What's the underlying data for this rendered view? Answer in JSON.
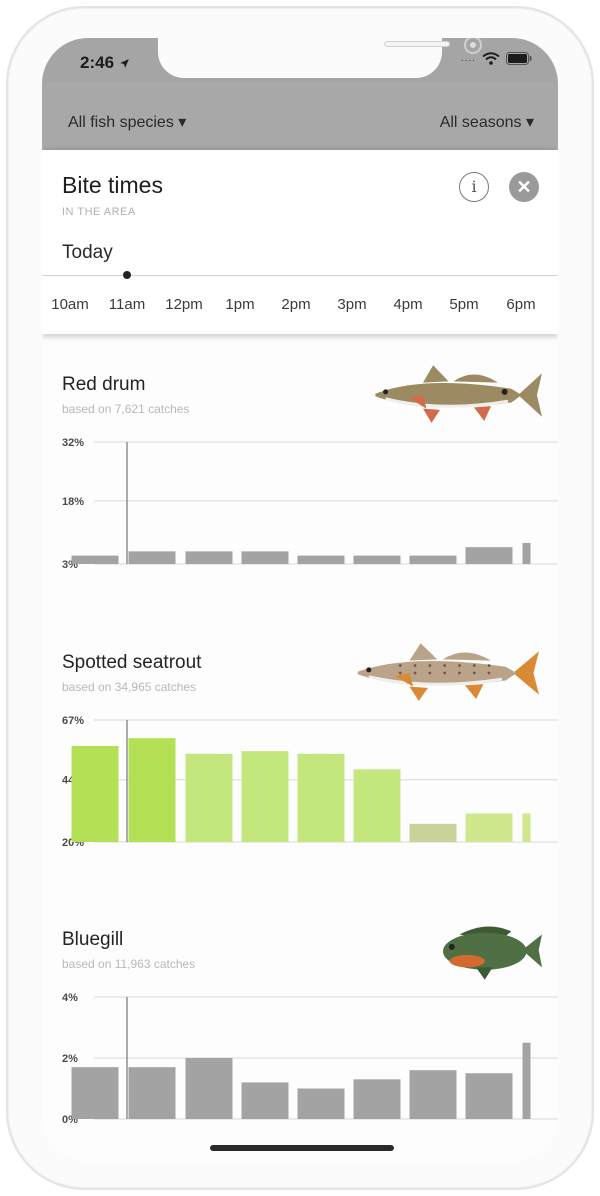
{
  "status_bar": {
    "time": "2:46",
    "location_icon": "location-arrow-icon",
    "signal": "....",
    "wifi_icon": "wifi-icon",
    "battery_icon": "battery-icon"
  },
  "filters": {
    "species": "All fish species ▾",
    "seasons": "All seasons ▾"
  },
  "sheet": {
    "title": "Bite times",
    "subtitle": "IN THE AREA",
    "info_label": "i",
    "close_label": "✕",
    "day": "Today",
    "hours": [
      "10am",
      "11am",
      "12pm",
      "1pm",
      "2pm",
      "3pm",
      "4pm",
      "5pm",
      "6pm"
    ],
    "current_time_index": 1
  },
  "species": [
    {
      "name": "Red drum",
      "based_on": "based on 7,621 catches",
      "fish_icon": "red-drum-fish-icon",
      "colors": {
        "body": "#9c8a63",
        "fin": "#d56a4a"
      },
      "chart_data": {
        "type": "bar",
        "categories": [
          "10am",
          "11am",
          "12pm",
          "1pm",
          "2pm",
          "3pm",
          "4pm",
          "5pm",
          "6pm"
        ],
        "values": [
          5,
          6,
          6,
          6,
          5,
          5,
          5,
          7,
          8
        ],
        "ytick_labels": [
          "32%",
          "18%",
          "3%"
        ],
        "yticks": [
          32,
          18,
          3
        ],
        "ylim": [
          3,
          32
        ],
        "bar_colors": [
          "#a3a3a3"
        ],
        "grid": true
      }
    },
    {
      "name": "Spotted seatrout",
      "based_on": "based on 34,965 catches",
      "fish_icon": "spotted-seatrout-fish-icon",
      "colors": {
        "body": "#bba389",
        "fin": "#d98a35"
      },
      "chart_data": {
        "type": "bar",
        "categories": [
          "10am",
          "11am",
          "12pm",
          "1pm",
          "2pm",
          "3pm",
          "4pm",
          "5pm",
          "6pm"
        ],
        "values": [
          57,
          60,
          54,
          55,
          54,
          48,
          27,
          31,
          31
        ],
        "ytick_labels": [
          "67%",
          "44%",
          "20%"
        ],
        "yticks": [
          67,
          44,
          20
        ],
        "ylim": [
          20,
          67
        ],
        "bar_colors": [
          "#b4e055",
          "#b4e055",
          "#c3e77d",
          "#c3e77d",
          "#c3e77d",
          "#c3e77d",
          "#c8d39a",
          "#cfe88d",
          "#cfe88d"
        ],
        "grid": true
      }
    },
    {
      "name": "Bluegill",
      "based_on": "based on 11,963 catches",
      "fish_icon": "bluegill-fish-icon",
      "colors": {
        "body": "#4f6f45",
        "fin": "#d46a2e"
      },
      "chart_data": {
        "type": "bar",
        "categories": [
          "10am",
          "11am",
          "12pm",
          "1pm",
          "2pm",
          "3pm",
          "4pm",
          "5pm",
          "6pm"
        ],
        "values": [
          1.7,
          1.7,
          2.0,
          1.2,
          1.0,
          1.3,
          1.6,
          1.5,
          2.5
        ],
        "ytick_labels": [
          "4%",
          "2%",
          "0%"
        ],
        "yticks": [
          4,
          2,
          0
        ],
        "ylim": [
          0,
          4
        ],
        "bar_colors": [
          "#a3a3a3"
        ],
        "grid": true
      }
    }
  ]
}
